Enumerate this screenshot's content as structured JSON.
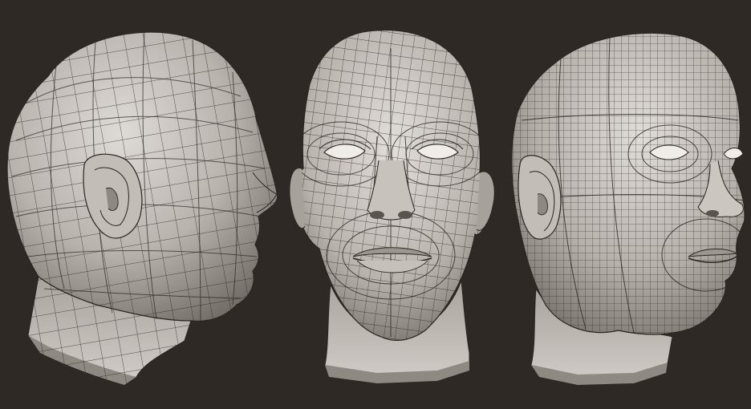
{
  "scene": {
    "background_color": "#2f2925",
    "skin_color": "#b9b3ae",
    "skin_highlight": "#dedad6",
    "skin_shadow": "#6f6964",
    "wire_color": "#2a2522",
    "views": [
      {
        "name": "side-profile",
        "facing": "right"
      },
      {
        "name": "front",
        "facing": "viewer"
      },
      {
        "name": "three-quarter",
        "facing": "right"
      }
    ]
  }
}
